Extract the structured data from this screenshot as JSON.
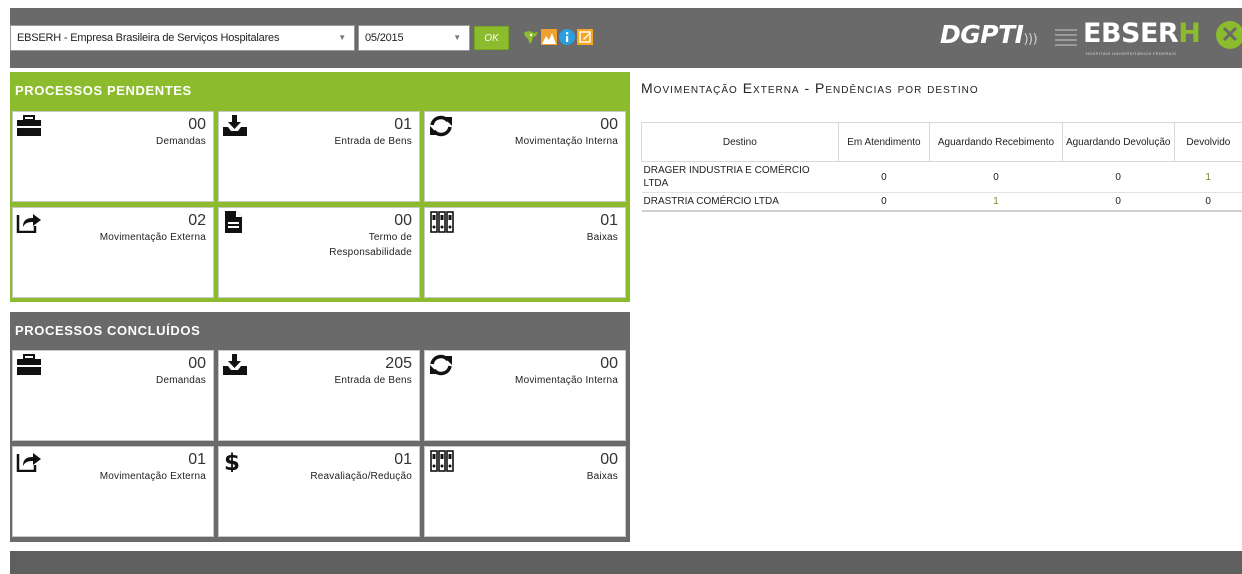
{
  "header": {
    "company_select": "EBSERH - Empresa Brasileira de Serviços Hospitalares",
    "period_select": "05/2015",
    "ok_label": "OK",
    "brand_dgpti": "DGPTI",
    "brand_ebserh_main": "EBSER",
    "brand_ebserh_h": "H",
    "brand_sub": "HOSPITAIS UNIVERSITÁRIOS FEDERAIS",
    "close_label": "✕",
    "tool_icons": [
      "map-icon",
      "chart-icon",
      "info-icon",
      "edit-icon"
    ]
  },
  "pendentes": {
    "title": "PROCESSOS PENDENTES",
    "tiles": [
      {
        "icon": "briefcase-icon",
        "count": "00",
        "label": "Demandas"
      },
      {
        "icon": "inbox-download-icon",
        "count": "01",
        "label": "Entrada de Bens"
      },
      {
        "icon": "refresh-icon",
        "count": "00",
        "label": "Movimentação Interna"
      },
      {
        "icon": "share-icon",
        "count": "02",
        "label": "Movimentação Externa"
      },
      {
        "icon": "document-icon",
        "count": "00",
        "label": "Termo de Responsabilidade"
      },
      {
        "icon": "archive-icon",
        "count": "01",
        "label": "Baixas"
      }
    ]
  },
  "concluidos": {
    "title": "PROCESSOS CONCLUÍDOS",
    "tiles": [
      {
        "icon": "briefcase-icon",
        "count": "00",
        "label": "Demandas"
      },
      {
        "icon": "inbox-download-icon",
        "count": "205",
        "label": "Entrada de Bens"
      },
      {
        "icon": "refresh-icon",
        "count": "00",
        "label": "Movimentação Interna"
      },
      {
        "icon": "share-icon",
        "count": "01",
        "label": "Movimentação Externa"
      },
      {
        "icon": "dollar-icon",
        "count": "01",
        "label": "Reavaliação/Redução"
      },
      {
        "icon": "archive-icon",
        "count": "00",
        "label": "Baixas"
      }
    ]
  },
  "movimentacao": {
    "title": "Movimentação Externa - Pendências por destino",
    "columns": [
      "Destino",
      "Em Atendimento",
      "Aguardando Recebimento",
      "Aguardando Devolução",
      "Devolvido"
    ],
    "rows": [
      {
        "destino": "DRAGER INDUSTRIA E COMÉRCIO LTDA",
        "em_atendimento": "0",
        "aguardando_recebimento": "0",
        "aguardando_devolucao": "0",
        "devolvido": "1"
      },
      {
        "destino": "DRASTRIA COMÉRCIO LTDA",
        "em_atendimento": "0",
        "aguardando_recebimento": "1",
        "aguardando_devolucao": "0",
        "devolvido": "0"
      }
    ]
  },
  "colors": {
    "accent_green": "#8cbb2d",
    "header_gray": "#6a6a6a",
    "link_green": "#6b8e23"
  }
}
